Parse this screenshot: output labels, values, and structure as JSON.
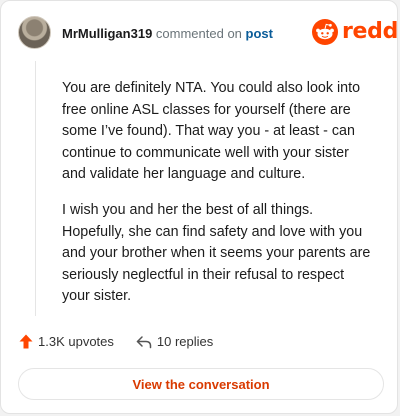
{
  "header": {
    "username": "MrMulligan319",
    "action_text": "commented on",
    "post_link": "post"
  },
  "brand": {
    "wordmark": "reddit",
    "color": "#ff4500"
  },
  "comment": {
    "paragraphs": [
      "You are definitely NTA. You could also look into free online ASL classes for yourself (there are some I’ve found). That way you - at least - can continue to communicate well with your sister and validate her language and culture.",
      "I wish you and her the best of all things. Hopefully, she can find safety and love with you and your brother when it seems your parents are seriously neglectful in their refusal to respect your sister."
    ]
  },
  "stats": {
    "upvotes_label": "1.3K upvotes",
    "replies_label": "10 replies"
  },
  "cta": {
    "label": "View the conversation"
  },
  "icons": {
    "avatar": "user-avatar",
    "logo": "reddit-snoo-icon",
    "upvote": "upvote-arrow-icon",
    "reply": "reply-arrow-icon"
  }
}
